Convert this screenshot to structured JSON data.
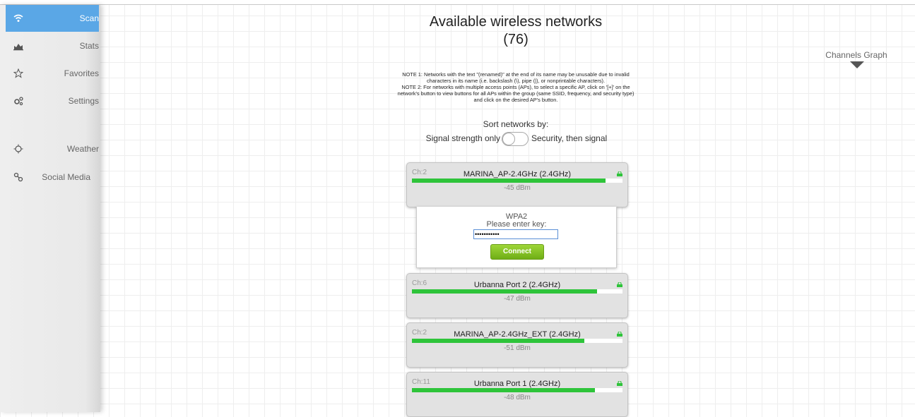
{
  "sidebar": {
    "items": [
      {
        "label": "Scan",
        "icon": "wifi-icon"
      },
      {
        "label": "Stats",
        "icon": "chart-icon"
      },
      {
        "label": "Favorites",
        "icon": "star-icon"
      },
      {
        "label": "Settings",
        "icon": "gears-icon"
      },
      {
        "label": "Weather",
        "icon": "sun-icon"
      },
      {
        "label": "Social Media",
        "icon": "share-icon"
      }
    ],
    "active_color": "#5aa7e6"
  },
  "main": {
    "title_line1": "Available wireless networks",
    "title_line2": "(76)",
    "channels_graph": "Channels Graph",
    "notes": "NOTE 1: Networks with the text \"(renamed)\" at the end of its name may be unusable due to invalid characters in its name (i.e. backslash (\\), pipe (|), or nonprintable characters).\nNOTE 2: For networks with multiple access points (APs), to select a specific AP, click on '[+]' on the network's button to view buttons for all APs within the group (same SSID, frequency, and security type) and click on the desired AP's button.",
    "sort_label": "Sort networks by:",
    "sort_left": "Signal strength only",
    "sort_right": "Security, then signal"
  },
  "networks": [
    {
      "ch": "Ch:2",
      "ssid": "MARINA_AP-2.4GHz (2.4GHz)",
      "dbm": "-45 dBm",
      "signal": 0.92
    },
    {
      "ch": "Ch:6",
      "ssid": "Urbanna Port 2 (2.4GHz)",
      "dbm": "-47 dBm",
      "signal": 0.88
    },
    {
      "ch": "Ch:2",
      "ssid": "MARINA_AP-2.4GHz_EXT (2.4GHz)",
      "dbm": "-51 dBm",
      "signal": 0.82
    },
    {
      "ch": "Ch:11",
      "ssid": "Urbanna Port 1 (2.4GHz)",
      "dbm": "-48 dBm",
      "signal": 0.87
    }
  ],
  "connect_panel": {
    "security": "WPA2",
    "prompt": "Please enter key:",
    "key_value": "•••••••••••",
    "button": "Connect"
  },
  "colors": {
    "signal_bar": "#2ec43a",
    "connect_button": "#7cbc1e"
  }
}
